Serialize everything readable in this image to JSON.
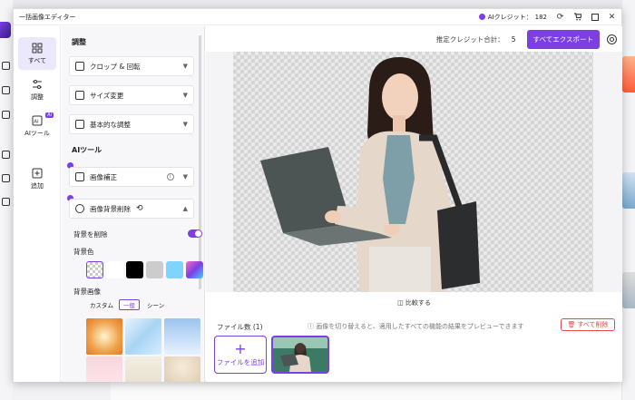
{
  "window": {
    "title": "一括画像エディター"
  },
  "titlebar": {
    "credits_label": "AIクレジット：",
    "credits_value": "182"
  },
  "nav": [
    {
      "label": "すべて",
      "active": true
    },
    {
      "label": "調整",
      "active": false
    },
    {
      "label": "AIツール",
      "active": false,
      "badge": "AI"
    },
    {
      "label": "追加",
      "active": false
    }
  ],
  "panel": {
    "adjust_title": "調整",
    "crop": "クロップ & 回転",
    "resize": "サイズ変更",
    "basic": "基本的な調整",
    "ai_title": "AIツール",
    "enhance": "画像補正",
    "bg_remove": "画像背景削除",
    "bg_remove_toggle": "背景を削除",
    "bg_color": "背景色",
    "bg_image": "背景画像",
    "tabs": [
      "カスタム",
      "一般",
      "シーン"
    ],
    "swatches": [
      "transparent",
      "#ffffff",
      "#000000",
      "#cccccc",
      "#7fd3ff",
      "gradient"
    ]
  },
  "main": {
    "credits_estimate_label": "推定クレジット合計：",
    "credits_estimate_value": "5",
    "export": "すべてエクスポート",
    "compare": "比較する",
    "files_count": "ファイル数 (1)",
    "hint": "画像を切り替えると、適用したすべての機能の結果をプレビューできます",
    "delete_all": "すべて削除",
    "add_file": "ファイルを追加"
  },
  "colors": {
    "accent": "#7b3fe4",
    "danger": "#e5484d"
  }
}
